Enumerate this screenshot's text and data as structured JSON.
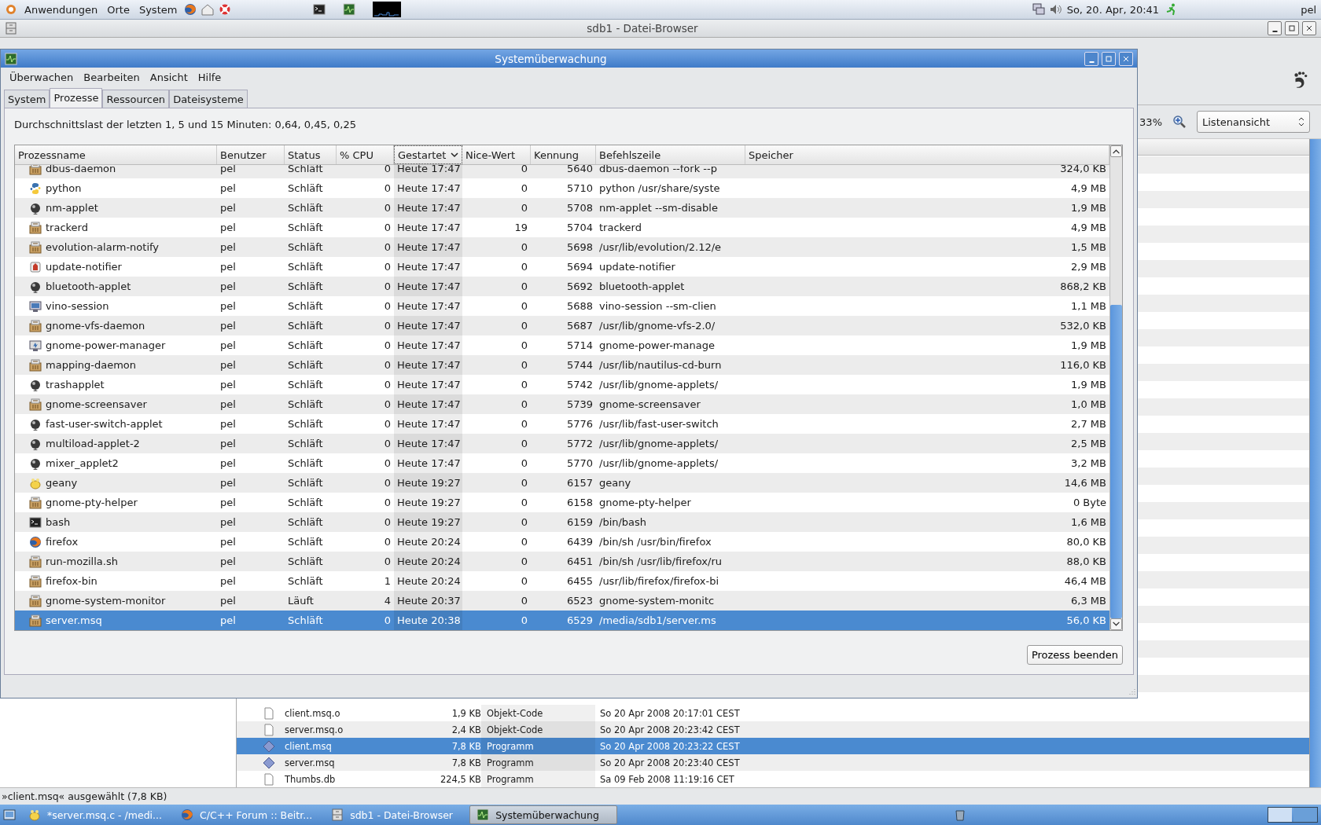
{
  "top_panel": {
    "menus": [
      "Anwendungen",
      "Orte",
      "System"
    ],
    "clock": "So, 20. Apr, 20:41",
    "user": "pel"
  },
  "file_browser": {
    "title": "sdb1 - Datei-Browser",
    "zoom_level": "33%",
    "view_mode": "Listenansicht",
    "files": [
      {
        "name": "client.msq.o",
        "size": "1,9 KB",
        "type": "Objekt-Code",
        "date": "So 20 Apr 2008 20:17:01 CEST",
        "kind": "document",
        "selected": false
      },
      {
        "name": "server.msq.o",
        "size": "2,4 KB",
        "type": "Objekt-Code",
        "date": "So 20 Apr 2008 20:23:42 CEST",
        "kind": "document",
        "selected": false
      },
      {
        "name": "client.msq",
        "size": "7,8 KB",
        "type": "Programm",
        "date": "So 20 Apr 2008 20:23:22 CEST",
        "kind": "diamond",
        "selected": true
      },
      {
        "name": "server.msq",
        "size": "7,8 KB",
        "type": "Programm",
        "date": "So 20 Apr 2008 20:23:40 CEST",
        "kind": "diamond",
        "selected": false
      },
      {
        "name": "Thumbs.db",
        "size": "224,5 KB",
        "type": "Programm",
        "date": "Sa 09 Feb 2008 11:19:16 CET",
        "kind": "document",
        "selected": false
      }
    ],
    "status_bar": "»client.msq« ausgewählt (7,8 KB)"
  },
  "system_monitor": {
    "title": "Systemüberwachung",
    "menu": [
      "Überwachen",
      "Bearbeiten",
      "Ansicht",
      "Hilfe"
    ],
    "tabs": [
      {
        "label": "System",
        "selected": false
      },
      {
        "label": "Prozesse",
        "selected": true
      },
      {
        "label": "Ressourcen",
        "selected": false
      },
      {
        "label": "Dateisysteme",
        "selected": false
      }
    ],
    "load_text": "Durchschnittslast der letzten 1, 5 und 15 Minuten: 0,64, 0,45, 0,25",
    "columns": [
      {
        "label": "Prozessname",
        "sorted": false
      },
      {
        "label": "Benutzer",
        "sorted": false
      },
      {
        "label": "Status",
        "sorted": false
      },
      {
        "label": "% CPU",
        "sorted": false
      },
      {
        "label": "Gestartet",
        "sorted": true
      },
      {
        "label": "Nice-Wert",
        "sorted": false
      },
      {
        "label": "Kennung",
        "sorted": false
      },
      {
        "label": "Befehlszeile",
        "sorted": false
      },
      {
        "label": "Speicher",
        "sorted": false
      }
    ],
    "rows": [
      {
        "kind": "box",
        "selected": false,
        "cells": [
          "dbus-daemon",
          "pel",
          "Schläft",
          "0",
          "Heute 17:47",
          "0",
          "5640",
          "dbus-daemon --fork --p",
          "324,0 KB"
        ]
      },
      {
        "kind": "python",
        "selected": false,
        "cells": [
          "python",
          "pel",
          "Schläft",
          "0",
          "Heute 17:47",
          "0",
          "5710",
          "python /usr/share/syste",
          "4,9 MB"
        ]
      },
      {
        "kind": "ball",
        "selected": false,
        "cells": [
          "nm-applet",
          "pel",
          "Schläft",
          "0",
          "Heute 17:47",
          "0",
          "5708",
          "nm-applet --sm-disable",
          "1,9 MB"
        ]
      },
      {
        "kind": "box",
        "selected": false,
        "cells": [
          "trackerd",
          "pel",
          "Schläft",
          "0",
          "Heute 17:47",
          "19",
          "5704",
          "trackerd",
          "4,9 MB"
        ]
      },
      {
        "kind": "box",
        "selected": false,
        "cells": [
          "evolution-alarm-notify",
          "pel",
          "Schläft",
          "0",
          "Heute 17:47",
          "0",
          "5698",
          "/usr/lib/evolution/2.12/e",
          "1,5 MB"
        ]
      },
      {
        "kind": "update",
        "selected": false,
        "cells": [
          "update-notifier",
          "pel",
          "Schläft",
          "0",
          "Heute 17:47",
          "0",
          "5694",
          "update-notifier",
          "2,9 MB"
        ]
      },
      {
        "kind": "ball",
        "selected": false,
        "cells": [
          "bluetooth-applet",
          "pel",
          "Schläft",
          "0",
          "Heute 17:47",
          "0",
          "5692",
          "bluetooth-applet",
          "868,2 KB"
        ]
      },
      {
        "kind": "monitor",
        "selected": false,
        "cells": [
          "vino-session",
          "pel",
          "Schläft",
          "0",
          "Heute 17:47",
          "0",
          "5688",
          "vino-session --sm-clien",
          "1,1 MB"
        ]
      },
      {
        "kind": "box",
        "selected": false,
        "cells": [
          "gnome-vfs-daemon",
          "pel",
          "Schläft",
          "0",
          "Heute 17:47",
          "0",
          "5687",
          "/usr/lib/gnome-vfs-2.0/",
          "532,0 KB"
        ]
      },
      {
        "kind": "power",
        "selected": false,
        "cells": [
          "gnome-power-manager",
          "pel",
          "Schläft",
          "0",
          "Heute 17:47",
          "0",
          "5714",
          "gnome-power-manage",
          "1,9 MB"
        ]
      },
      {
        "kind": "box",
        "selected": false,
        "cells": [
          "mapping-daemon",
          "pel",
          "Schläft",
          "0",
          "Heute 17:47",
          "0",
          "5744",
          "/usr/lib/nautilus-cd-burn",
          "116,0 KB"
        ]
      },
      {
        "kind": "ball",
        "selected": false,
        "cells": [
          "trashapplet",
          "pel",
          "Schläft",
          "0",
          "Heute 17:47",
          "0",
          "5742",
          "/usr/lib/gnome-applets/",
          "1,9 MB"
        ]
      },
      {
        "kind": "box",
        "selected": false,
        "cells": [
          "gnome-screensaver",
          "pel",
          "Schläft",
          "0",
          "Heute 17:47",
          "0",
          "5739",
          "gnome-screensaver",
          "1,0 MB"
        ]
      },
      {
        "kind": "ball",
        "selected": false,
        "cells": [
          "fast-user-switch-applet",
          "pel",
          "Schläft",
          "0",
          "Heute 17:47",
          "0",
          "5776",
          "/usr/lib/fast-user-switch",
          "2,7 MB"
        ]
      },
      {
        "kind": "ball",
        "selected": false,
        "cells": [
          "multiload-applet-2",
          "pel",
          "Schläft",
          "0",
          "Heute 17:47",
          "0",
          "5772",
          "/usr/lib/gnome-applets/",
          "2,5 MB"
        ]
      },
      {
        "kind": "ball",
        "selected": false,
        "cells": [
          "mixer_applet2",
          "pel",
          "Schläft",
          "0",
          "Heute 17:47",
          "0",
          "5770",
          "/usr/lib/gnome-applets/",
          "3,2 MB"
        ]
      },
      {
        "kind": "geany",
        "selected": false,
        "cells": [
          "geany",
          "pel",
          "Schläft",
          "0",
          "Heute 19:27",
          "0",
          "6157",
          "geany",
          "14,6 MB"
        ]
      },
      {
        "kind": "box",
        "selected": false,
        "cells": [
          "gnome-pty-helper",
          "pel",
          "Schläft",
          "0",
          "Heute 19:27",
          "0",
          "6158",
          "gnome-pty-helper",
          "0 Byte"
        ]
      },
      {
        "kind": "terminal",
        "selected": false,
        "cells": [
          "bash",
          "pel",
          "Schläft",
          "0",
          "Heute 19:27",
          "0",
          "6159",
          "/bin/bash",
          "1,6 MB"
        ]
      },
      {
        "kind": "globe",
        "selected": false,
        "cells": [
          "firefox",
          "pel",
          "Schläft",
          "0",
          "Heute 20:24",
          "0",
          "6439",
          "/bin/sh /usr/bin/firefox",
          "80,0 KB"
        ]
      },
      {
        "kind": "box",
        "selected": false,
        "cells": [
          "run-mozilla.sh",
          "pel",
          "Schläft",
          "0",
          "Heute 20:24",
          "0",
          "6451",
          "/bin/sh /usr/lib/firefox/ru",
          "88,0 KB"
        ]
      },
      {
        "kind": "box",
        "selected": false,
        "cells": [
          "firefox-bin",
          "pel",
          "Schläft",
          "1",
          "Heute 20:24",
          "0",
          "6455",
          "/usr/lib/firefox/firefox-bi",
          "46,4 MB"
        ]
      },
      {
        "kind": "box",
        "selected": false,
        "cells": [
          "gnome-system-monitor",
          "pel",
          "Läuft",
          "4",
          "Heute 20:37",
          "0",
          "6523",
          "gnome-system-monitc",
          "6,3 MB"
        ]
      },
      {
        "kind": "box",
        "selected": true,
        "cells": [
          "server.msq",
          "pel",
          "Schläft",
          "0",
          "Heute 20:38",
          "0",
          "6529",
          "/media/sdb1/server.ms",
          "56,0 KB"
        ]
      }
    ],
    "end_button": "Prozess beenden"
  },
  "taskbar": {
    "tasks": [
      {
        "kind": "geany",
        "label": "*server.msq.c - /medi...",
        "selected": false
      },
      {
        "kind": "globe",
        "label": "C/C++ Forum :: Beitr...",
        "selected": false
      },
      {
        "kind": "cabinet",
        "label": "sdb1 - Datei-Browser",
        "selected": false
      },
      {
        "kind": "meter",
        "label": "Systemüberwachung",
        "selected": true
      }
    ]
  }
}
